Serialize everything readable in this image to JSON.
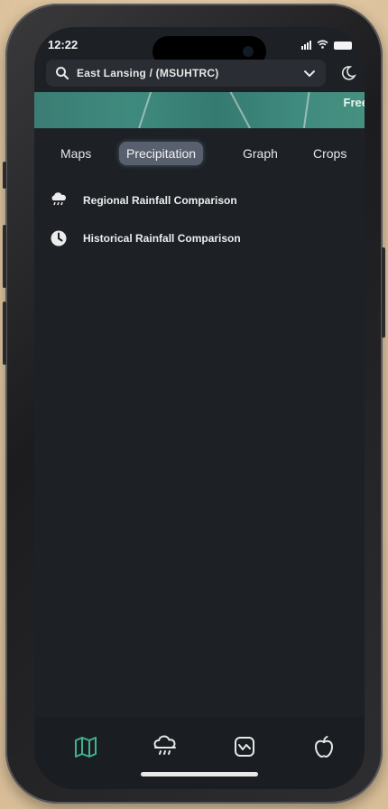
{
  "status_bar": {
    "time": "12:22"
  },
  "search": {
    "location": "East Lansing / (MSUHTRC)"
  },
  "map": {
    "label": "Free"
  },
  "tabs": [
    {
      "label": "Maps",
      "active": false
    },
    {
      "label": "Precipitation",
      "active": true
    },
    {
      "label": "Graph",
      "active": false
    },
    {
      "label": "Crops",
      "active": false
    }
  ],
  "menu": {
    "items": [
      {
        "label": "Regional Rainfall Comparison",
        "icon": "rain-cloud-icon"
      },
      {
        "label": "Historical Rainfall Comparison",
        "icon": "history-clock-icon"
      }
    ]
  },
  "tab_bar": {
    "items": [
      {
        "icon": "map-icon",
        "active": true
      },
      {
        "icon": "rain-cloud-icon",
        "active": false
      },
      {
        "icon": "graph-icon",
        "active": false
      },
      {
        "icon": "apple-icon",
        "active": false
      }
    ]
  },
  "colors": {
    "background": "#1d2126",
    "active_tab": "#58606e",
    "accent_map": "#3f8a7e",
    "active_nav_icon": "#3fb48d"
  }
}
